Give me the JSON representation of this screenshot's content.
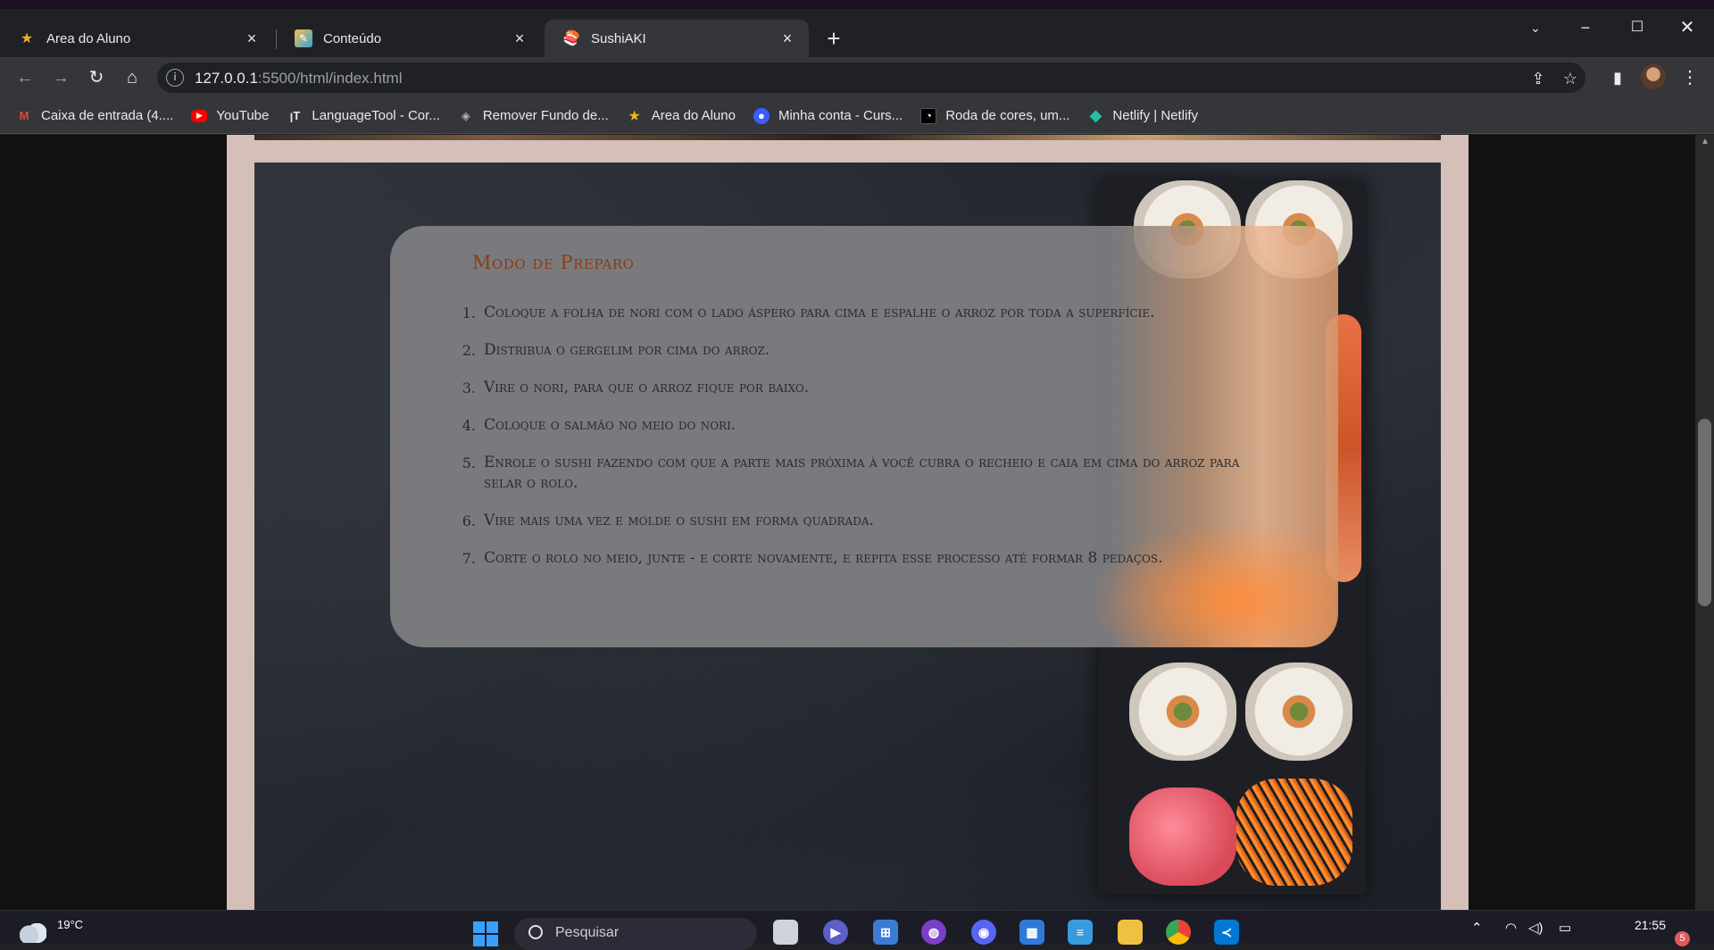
{
  "browser": {
    "tabs": [
      {
        "label": "Area do Aluno",
        "icon": "star-logo-icon"
      },
      {
        "label": "Conteúdo",
        "icon": "pencil-note-icon"
      },
      {
        "label": "SushiAKI",
        "icon": "sushi-logo-icon",
        "active": true
      }
    ],
    "url": {
      "host": "127.0.0.1",
      "rest": ":5500/html/index.html"
    },
    "bookmarks": [
      {
        "label": "Caixa de entrada (4....",
        "icon": "gmail-icon",
        "color": "#ea4335"
      },
      {
        "label": "YouTube",
        "icon": "youtube-icon",
        "color": "#ff0000"
      },
      {
        "label": "LanguageTool - Cor...",
        "icon": "languagetool-icon",
        "color": "#e8eaed"
      },
      {
        "label": "Remover Fundo de...",
        "icon": "layers-icon",
        "color": "#b0b4bb"
      },
      {
        "label": "Area do Aluno",
        "icon": "star-logo-icon",
        "color": "#e8b320"
      },
      {
        "label": "Minha conta - Curs...",
        "icon": "course-icon",
        "color": "#3b5cff"
      },
      {
        "label": "Roda de cores, um...",
        "icon": "color-wheel-icon",
        "color": "#ffffff"
      },
      {
        "label": "Netlify | Netlify",
        "icon": "netlify-icon",
        "color": "#25c2a0"
      }
    ]
  },
  "page": {
    "section_title": "Modo de Preparo",
    "steps": [
      {
        "num": "1.",
        "text": "Coloque a folha de nori com o lado áspero para cima e espalhe o arroz por toda a superfície."
      },
      {
        "num": "2.",
        "text": "Distribua o gergelim por cima do arroz."
      },
      {
        "num": "3.",
        "text": "Vire o nori, para que o arroz fique por baixo."
      },
      {
        "num": "4.",
        "text": "Coloque o salmão no meio do nori."
      },
      {
        "num": "5.",
        "text": "Enrole o sushi fazendo com que a parte mais próxima à você cubra o recheio e caia em cima do arroz para selar o rolo."
      },
      {
        "num": "6.",
        "text": "Vire mais uma vez e molde o sushi em forma quadrada."
      },
      {
        "num": "7.",
        "text": "Corte o rolo no meio, junte - e corte novamente, e repita esse processo até formar 8 pedaços."
      }
    ],
    "accent_color": "#8a3d10"
  },
  "taskbar": {
    "weather_temp": "19°C",
    "search_placeholder": "Pesquisar",
    "time": "21:55",
    "notification_count": "5"
  }
}
